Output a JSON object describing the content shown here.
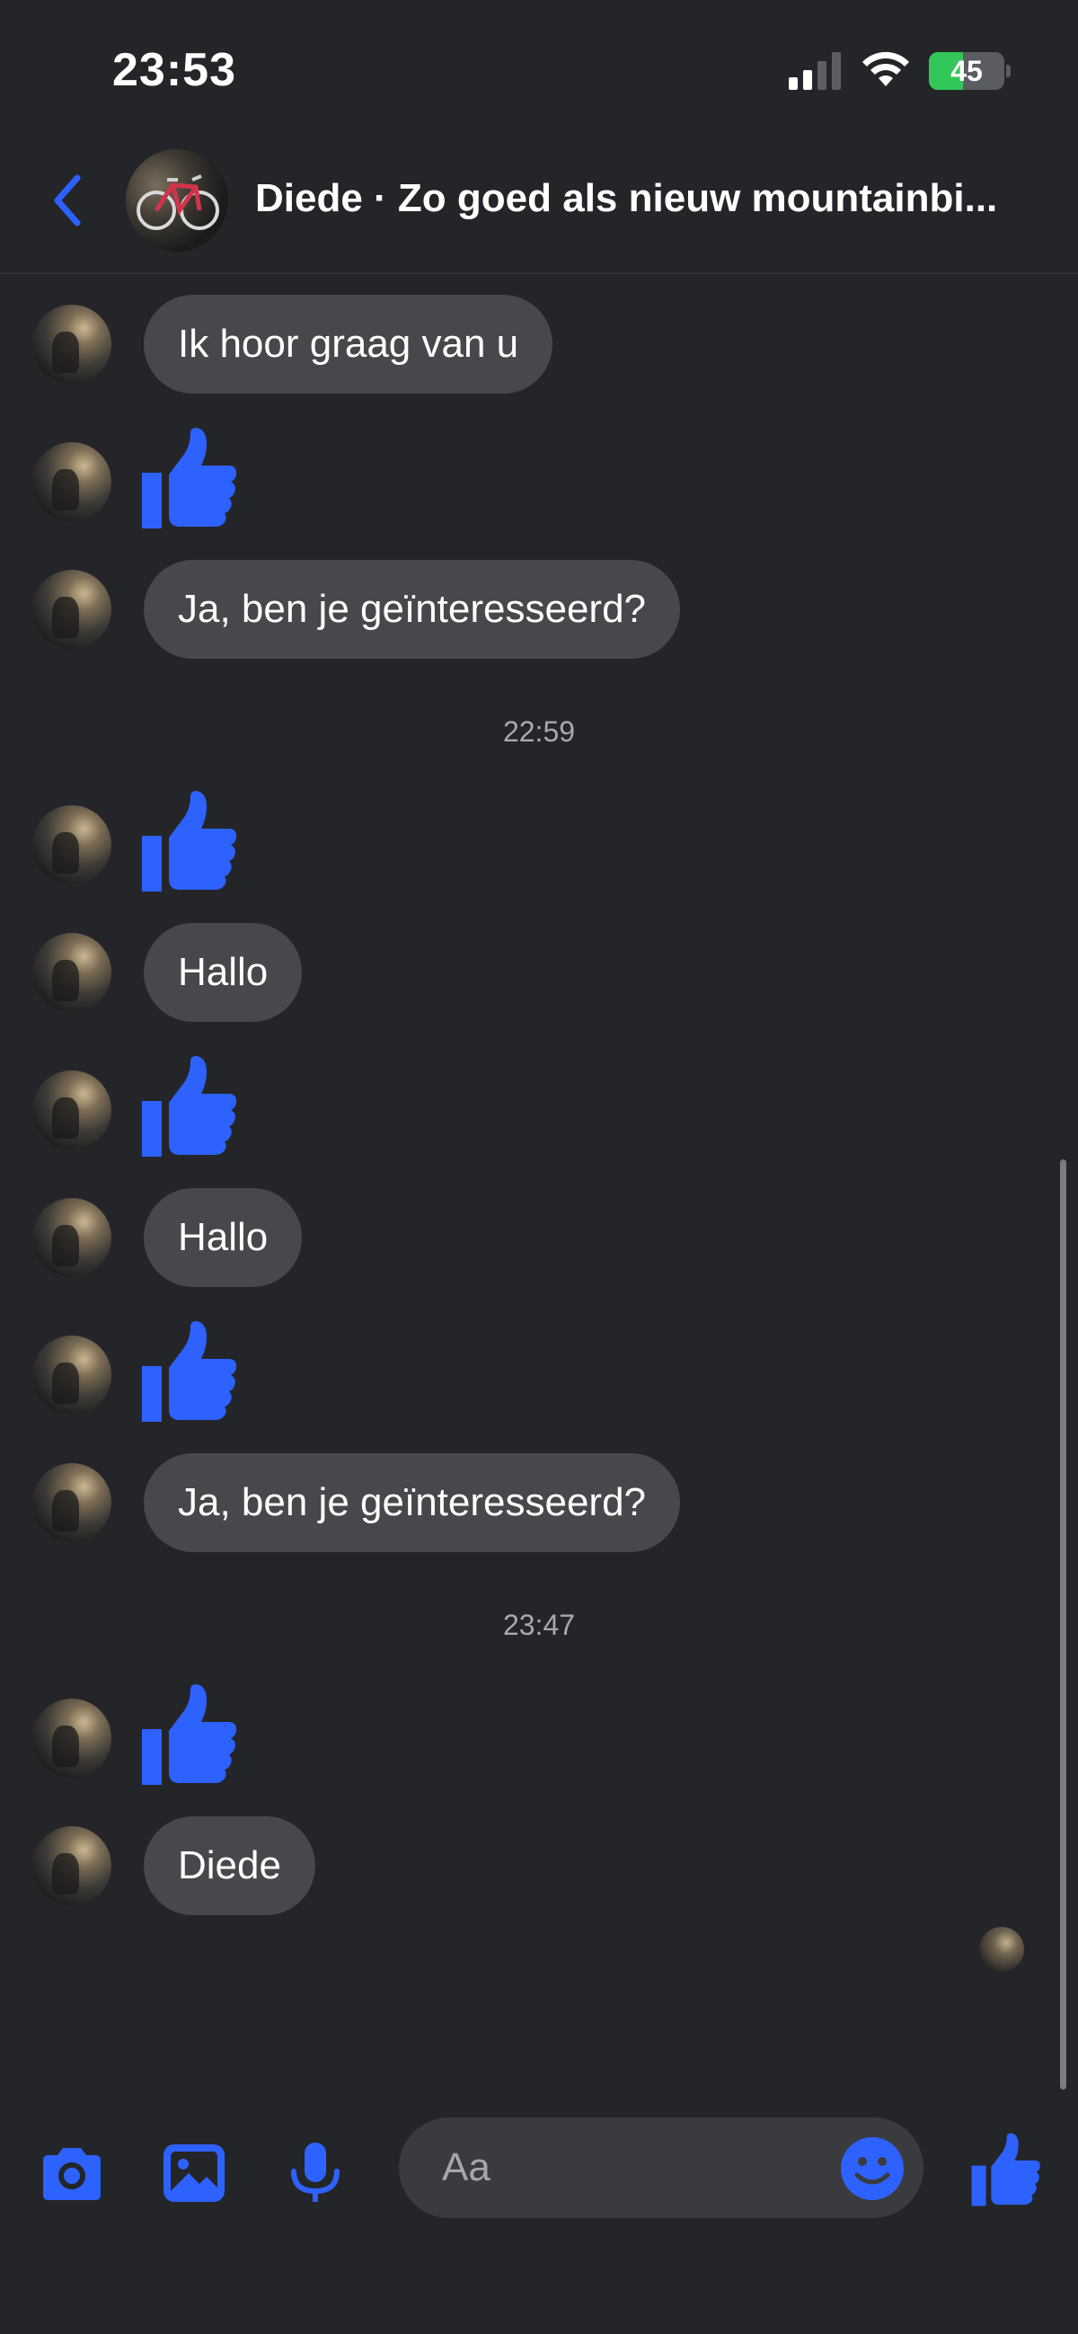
{
  "status_bar": {
    "time": "23:53",
    "battery_level": "45"
  },
  "header": {
    "title": "Diede · Zo goed als nieuw mountainbi..."
  },
  "messages": [
    {
      "type": "text",
      "text": "Ik hoor graag van u"
    },
    {
      "type": "like"
    },
    {
      "type": "text",
      "text": "Ja, ben je geïnteresseerd?"
    },
    {
      "type": "timestamp",
      "text": "22:59"
    },
    {
      "type": "like"
    },
    {
      "type": "text",
      "text": "Hallo"
    },
    {
      "type": "like"
    },
    {
      "type": "text",
      "text": "Hallo"
    },
    {
      "type": "like"
    },
    {
      "type": "text",
      "text": "Ja, ben je geïnteresseerd?"
    },
    {
      "type": "timestamp",
      "text": "23:47"
    },
    {
      "type": "like"
    },
    {
      "type": "text",
      "text": "Diede"
    }
  ],
  "composer": {
    "placeholder": "Aa"
  },
  "colors": {
    "accent": "#2e62ff",
    "bubble": "#46484c",
    "background": "#242529",
    "battery_green": "#33c759"
  },
  "icons": [
    "back-chevron-icon",
    "camera-icon",
    "image-icon",
    "microphone-icon",
    "emoji-icon",
    "thumbs-up-icon"
  ]
}
